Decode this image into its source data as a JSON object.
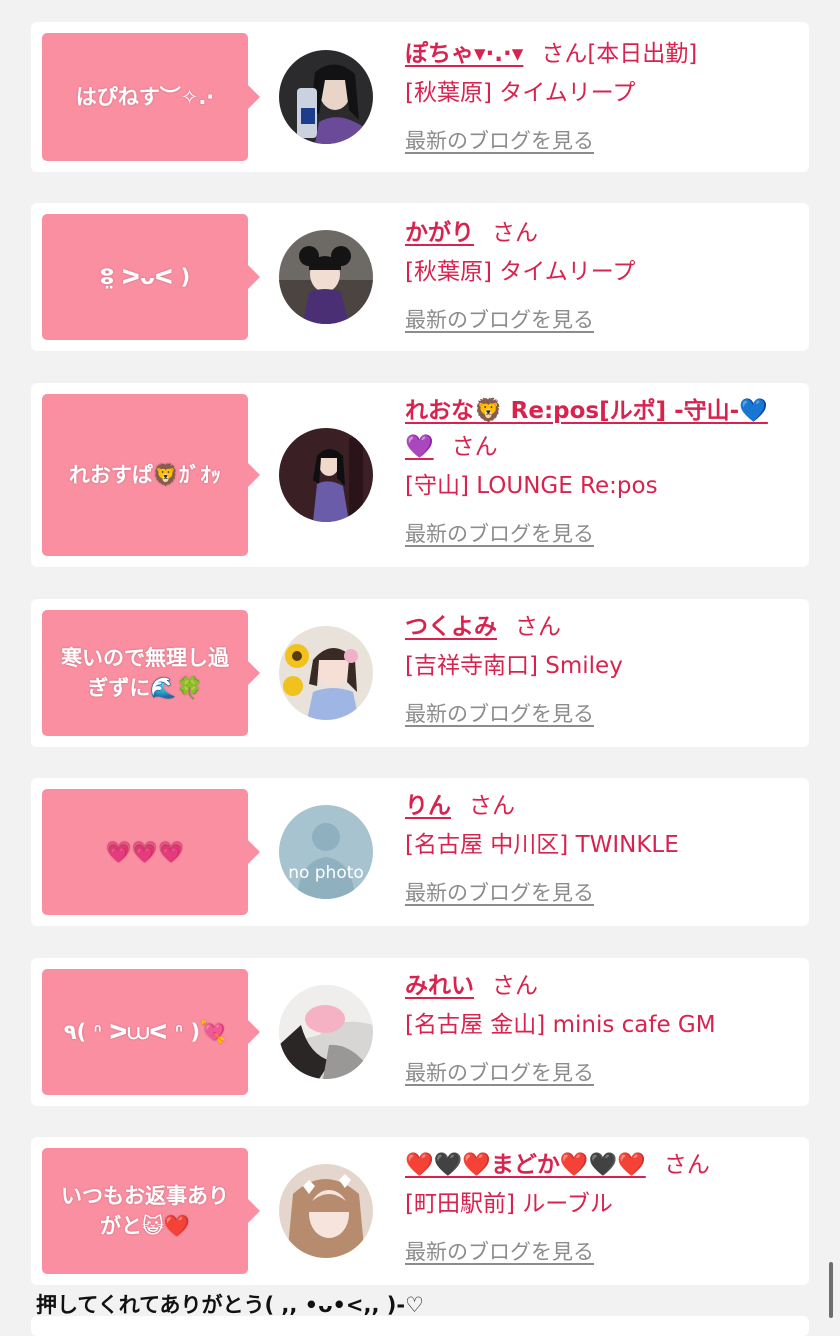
{
  "entries": [
    {
      "comment": "はぴねす︶✧.·",
      "name": "ぽちゃ▾·.·▾",
      "honorific": "さん",
      "status": "[本日出勤]",
      "shop": "[秋葉原] タイムリープ",
      "blog_link": "最新のブログを見る",
      "avatar_icon": "girl-photo"
    },
    {
      "comment": "ⵓ̤ ᐳᴗᐸ )",
      "name": "かがり",
      "honorific": "さん",
      "status": "",
      "shop": "[秋葉原] タイムリープ",
      "blog_link": "最新のブログを見る",
      "avatar_icon": "girl-photo"
    },
    {
      "comment": "れおすぱ🦁ｶﾞｵｯ",
      "name": "れおな🦁 Re:pos[ルポ] -守山-💙💜",
      "honorific": "さん",
      "status": "",
      "shop": "[守山] LOUNGE Re:pos",
      "blog_link": "最新のブログを見る",
      "avatar_icon": "girl-photo"
    },
    {
      "comment": "寒いので無理し過ぎずに🌊🍀",
      "name": "つくよみ",
      "honorific": "さん",
      "status": "",
      "shop": "[吉祥寺南口] Smiley",
      "blog_link": "最新のブログを見る",
      "avatar_icon": "girl-photo"
    },
    {
      "comment": "💗💗💗",
      "name": "りん",
      "honorific": "さん",
      "status": "",
      "shop": "[名古屋 中川区] TWINKLE",
      "blog_link": "最新のブログを見る",
      "avatar_icon": "no-photo",
      "avatar_text": "no photo"
    },
    {
      "comment": "٩( ᐢ ᐳ⩊ᐸ ᐢ )💘",
      "name": "みれい",
      "honorific": "さん",
      "status": "",
      "shop": "[名古屋 金山] minis cafe GM",
      "blog_link": "最新のブログを見る",
      "avatar_icon": "girl-photo"
    },
    {
      "comment": "いつもお返事ありがと😺❤️",
      "name": "❤️🖤❤️まどか❤️🖤❤️",
      "honorific": "さん",
      "status": "",
      "shop": "[町田駅前] ルーブル",
      "blog_link": "最新のブログを見る",
      "avatar_icon": "girl-photo"
    }
  ],
  "footer_text": "押してくれてありがとう( ,, •ᴗ•<,, )-♡",
  "colors": {
    "bubble": "#fb8fa2",
    "name": "#d8234f",
    "blog_link": "#8c8c8c",
    "background": "#f2f2f2"
  }
}
